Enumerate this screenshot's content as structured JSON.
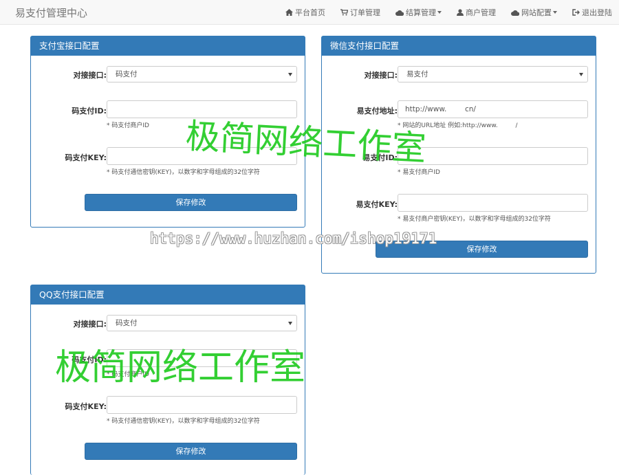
{
  "navbar": {
    "brand": "易支付管理中心",
    "items": [
      {
        "label": "平台首页",
        "icon": "home-icon"
      },
      {
        "label": "订单管理",
        "icon": "cart-icon"
      },
      {
        "label": "结算管理",
        "icon": "cloud-icon",
        "dropdown": true
      },
      {
        "label": "商户管理",
        "icon": "user-icon"
      },
      {
        "label": "网站配置",
        "icon": "cloud-icon",
        "dropdown": true
      },
      {
        "label": "退出登陆",
        "icon": "logout-icon"
      }
    ]
  },
  "alipay": {
    "title": "支付宝接口配置",
    "interface_label": "对接接口:",
    "interface_value": "码支付",
    "id_label": "码支付ID:",
    "id_help": "* 码支付商户ID",
    "key_label": "码支付KEY:",
    "key_help": "* 码支付通信密钥(KEY)，以数字和字母组成的32位字符",
    "save": "保存修改"
  },
  "wechat": {
    "title": "微信支付接口配置",
    "interface_label": "对接接口:",
    "interface_value": "易支付",
    "addr_label": "易支付地址:",
    "addr_value": "http://www.        cn/",
    "addr_help": "* 网站的URL地址 例如:http://www.         /",
    "id_label": "易支付ID:",
    "id_help": "* 易支付商户ID",
    "key_label": "易支付KEY:",
    "key_help": "* 易支付商户密钥(KEY)，以数字和字母组成的32位字符",
    "save": "保存修改"
  },
  "qq": {
    "title": "QQ支付接口配置",
    "interface_label": "对接接口:",
    "interface_value": "码支付",
    "id_label": "码支付ID:",
    "id_help": "* 码支付商户ID",
    "key_label": "码支付KEY:",
    "key_help": "* 码支付通信密钥(KEY)，以数字和字母组成的32位字符",
    "save": "保存修改"
  },
  "watermarks": {
    "studio_1": "极简网络工作室",
    "studio_2": "极简网络工作室",
    "url": "https://www.huzhan.com/ishop19171"
  },
  "colors": {
    "primary": "#337ab7",
    "watermark": "#22cc22"
  }
}
